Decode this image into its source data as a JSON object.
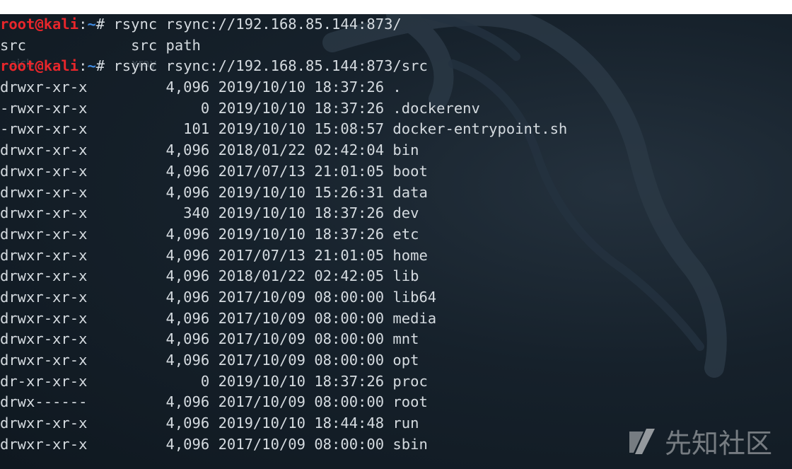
{
  "terminal": {
    "prompt": {
      "user_host": "root@kali",
      "separator": ":",
      "cwd": "~",
      "symbol": "#"
    },
    "commands": [
      "rsync rsync://192.168.85.144:873/",
      "rsync rsync://192.168.85.144:873/src"
    ],
    "module_listing": {
      "name": "src",
      "comment": "src path"
    },
    "background_ghost_text": [
      "aich",
      "xray"
    ],
    "listing": [
      {
        "perms": "drwxr-xr-x",
        "size": "4,096",
        "date": "2019/10/10",
        "time": "18:37:26",
        "name": "."
      },
      {
        "perms": "-rwxr-xr-x",
        "size": "0",
        "date": "2019/10/10",
        "time": "18:37:26",
        "name": ".dockerenv"
      },
      {
        "perms": "-rwxr-xr-x",
        "size": "101",
        "date": "2019/10/10",
        "time": "15:08:57",
        "name": "docker-entrypoint.sh"
      },
      {
        "perms": "drwxr-xr-x",
        "size": "4,096",
        "date": "2018/01/22",
        "time": "02:42:04",
        "name": "bin"
      },
      {
        "perms": "drwxr-xr-x",
        "size": "4,096",
        "date": "2017/07/13",
        "time": "21:01:05",
        "name": "boot"
      },
      {
        "perms": "drwxr-xr-x",
        "size": "4,096",
        "date": "2019/10/10",
        "time": "15:26:31",
        "name": "data"
      },
      {
        "perms": "drwxr-xr-x",
        "size": "340",
        "date": "2019/10/10",
        "time": "18:37:26",
        "name": "dev"
      },
      {
        "perms": "drwxr-xr-x",
        "size": "4,096",
        "date": "2019/10/10",
        "time": "18:37:26",
        "name": "etc"
      },
      {
        "perms": "drwxr-xr-x",
        "size": "4,096",
        "date": "2017/07/13",
        "time": "21:01:05",
        "name": "home"
      },
      {
        "perms": "drwxr-xr-x",
        "size": "4,096",
        "date": "2018/01/22",
        "time": "02:42:05",
        "name": "lib"
      },
      {
        "perms": "drwxr-xr-x",
        "size": "4,096",
        "date": "2017/10/09",
        "time": "08:00:00",
        "name": "lib64"
      },
      {
        "perms": "drwxr-xr-x",
        "size": "4,096",
        "date": "2017/10/09",
        "time": "08:00:00",
        "name": "media"
      },
      {
        "perms": "drwxr-xr-x",
        "size": "4,096",
        "date": "2017/10/09",
        "time": "08:00:00",
        "name": "mnt"
      },
      {
        "perms": "drwxr-xr-x",
        "size": "4,096",
        "date": "2017/10/09",
        "time": "08:00:00",
        "name": "opt"
      },
      {
        "perms": "dr-xr-xr-x",
        "size": "0",
        "date": "2019/10/10",
        "time": "18:37:26",
        "name": "proc"
      },
      {
        "perms": "drwx------",
        "size": "4,096",
        "date": "2017/10/09",
        "time": "08:00:00",
        "name": "root"
      },
      {
        "perms": "drwxr-xr-x",
        "size": "4,096",
        "date": "2019/10/10",
        "time": "18:44:48",
        "name": "run"
      },
      {
        "perms": "drwxr-xr-x",
        "size": "4,096",
        "date": "2017/10/09",
        "time": "08:00:00",
        "name": "sbin"
      }
    ]
  },
  "watermark": {
    "text": "先知社区"
  },
  "colors": {
    "prompt_user": "#e8262b",
    "prompt_path": "#3f8ae0",
    "text": "#d5dbe0",
    "background": "#16212b"
  }
}
